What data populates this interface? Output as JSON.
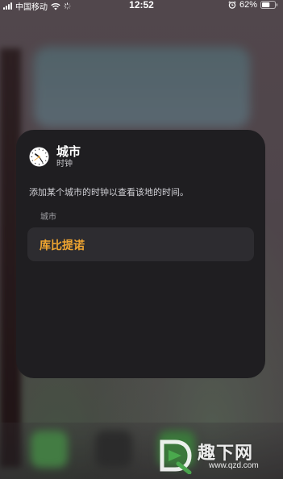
{
  "status_bar": {
    "carrier": "中国移动",
    "time": "12:52",
    "battery_percent": "62%",
    "battery_level": 0.62,
    "icons": [
      "signal-icon",
      "wifi-icon",
      "loading-icon",
      "alarm-icon",
      "battery-icon"
    ]
  },
  "widget": {
    "title": "城市",
    "subtitle": "时钟",
    "description": "添加某个城市的时钟以查看该地的时间。",
    "section_label": "城市",
    "city_value": "库比提诺",
    "accent_color": "#f0a530",
    "icon": "clock-app-icon"
  },
  "watermark": {
    "text": "趣下网",
    "url": "www.qzd.com"
  }
}
